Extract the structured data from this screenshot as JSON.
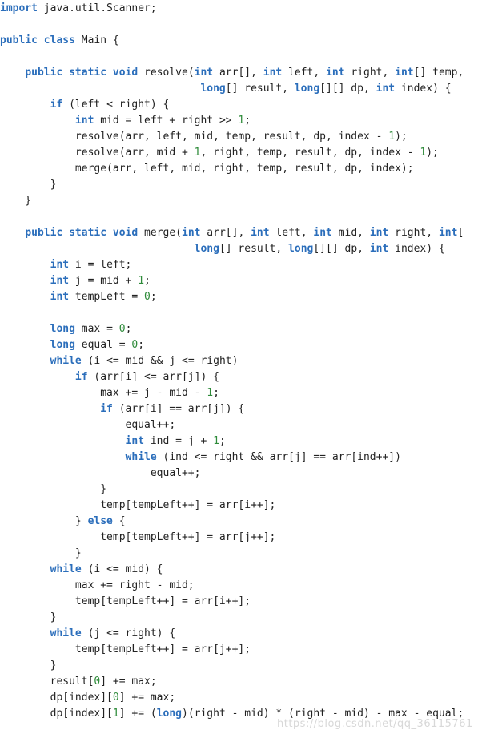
{
  "editor": {
    "language": "java",
    "background_color": "#ffffff",
    "default_text_color": "#222222",
    "keyword_color": "#2B6EBB",
    "number_color": "#2E8B3A",
    "font_size_px": 13,
    "line_height_px": 20
  },
  "watermark": {
    "text": "https://blog.csdn.net/qq_36115761"
  },
  "code": {
    "lines": [
      [
        [
          "kw",
          "import"
        ],
        [
          "plain",
          " java.util.Scanner;"
        ]
      ],
      [],
      [
        [
          "kw",
          "public class"
        ],
        [
          "plain",
          " Main {"
        ]
      ],
      [],
      [
        [
          "plain",
          "    "
        ],
        [
          "kw",
          "public static void"
        ],
        [
          "plain",
          " resolve("
        ],
        [
          "kw",
          "int"
        ],
        [
          "plain",
          " arr[], "
        ],
        [
          "kw",
          "int"
        ],
        [
          "plain",
          " left, "
        ],
        [
          "kw",
          "int"
        ],
        [
          "plain",
          " right, "
        ],
        [
          "kw",
          "int"
        ],
        [
          "plain",
          "[] temp,"
        ]
      ],
      [
        [
          "plain",
          "                                "
        ],
        [
          "kw",
          "long"
        ],
        [
          "plain",
          "[] result, "
        ],
        [
          "kw",
          "long"
        ],
        [
          "plain",
          "[][] dp, "
        ],
        [
          "kw",
          "int"
        ],
        [
          "plain",
          " index) {"
        ]
      ],
      [
        [
          "plain",
          "        "
        ],
        [
          "kw",
          "if"
        ],
        [
          "plain",
          " (left < right) {"
        ]
      ],
      [
        [
          "plain",
          "            "
        ],
        [
          "kw",
          "int"
        ],
        [
          "plain",
          " mid = left + right >> "
        ],
        [
          "num",
          "1"
        ],
        [
          "plain",
          ";"
        ]
      ],
      [
        [
          "plain",
          "            resolve(arr, left, mid, temp, result, dp, index - "
        ],
        [
          "num",
          "1"
        ],
        [
          "plain",
          ");"
        ]
      ],
      [
        [
          "plain",
          "            resolve(arr, mid + "
        ],
        [
          "num",
          "1"
        ],
        [
          "plain",
          ", right, temp, result, dp, index - "
        ],
        [
          "num",
          "1"
        ],
        [
          "plain",
          ");"
        ]
      ],
      [
        [
          "plain",
          "            merge(arr, left, mid, right, temp, result, dp, index);"
        ]
      ],
      [
        [
          "plain",
          "        }"
        ]
      ],
      [
        [
          "plain",
          "    }"
        ]
      ],
      [],
      [
        [
          "plain",
          "    "
        ],
        [
          "kw",
          "public static void"
        ],
        [
          "plain",
          " merge("
        ],
        [
          "kw",
          "int"
        ],
        [
          "plain",
          " arr[], "
        ],
        [
          "kw",
          "int"
        ],
        [
          "plain",
          " left, "
        ],
        [
          "kw",
          "int"
        ],
        [
          "plain",
          " mid, "
        ],
        [
          "kw",
          "int"
        ],
        [
          "plain",
          " right, "
        ],
        [
          "kw",
          "int"
        ],
        [
          "plain",
          "["
        ]
      ],
      [
        [
          "plain",
          "                               "
        ],
        [
          "kw",
          "long"
        ],
        [
          "plain",
          "[] result, "
        ],
        [
          "kw",
          "long"
        ],
        [
          "plain",
          "[][] dp, "
        ],
        [
          "kw",
          "int"
        ],
        [
          "plain",
          " index) {"
        ]
      ],
      [
        [
          "plain",
          "        "
        ],
        [
          "kw",
          "int"
        ],
        [
          "plain",
          " i = left;"
        ]
      ],
      [
        [
          "plain",
          "        "
        ],
        [
          "kw",
          "int"
        ],
        [
          "plain",
          " j = mid + "
        ],
        [
          "num",
          "1"
        ],
        [
          "plain",
          ";"
        ]
      ],
      [
        [
          "plain",
          "        "
        ],
        [
          "kw",
          "int"
        ],
        [
          "plain",
          " tempLeft = "
        ],
        [
          "num",
          "0"
        ],
        [
          "plain",
          ";"
        ]
      ],
      [],
      [
        [
          "plain",
          "        "
        ],
        [
          "kw",
          "long"
        ],
        [
          "plain",
          " max = "
        ],
        [
          "num",
          "0"
        ],
        [
          "plain",
          ";"
        ]
      ],
      [
        [
          "plain",
          "        "
        ],
        [
          "kw",
          "long"
        ],
        [
          "plain",
          " equal = "
        ],
        [
          "num",
          "0"
        ],
        [
          "plain",
          ";"
        ]
      ],
      [
        [
          "plain",
          "        "
        ],
        [
          "kw",
          "while"
        ],
        [
          "plain",
          " (i <= mid && j <= right)"
        ]
      ],
      [
        [
          "plain",
          "            "
        ],
        [
          "kw",
          "if"
        ],
        [
          "plain",
          " (arr[i] <= arr[j]) {"
        ]
      ],
      [
        [
          "plain",
          "                max += j - mid - "
        ],
        [
          "num",
          "1"
        ],
        [
          "plain",
          ";"
        ]
      ],
      [
        [
          "plain",
          "                "
        ],
        [
          "kw",
          "if"
        ],
        [
          "plain",
          " (arr[i] == arr[j]) {"
        ]
      ],
      [
        [
          "plain",
          "                    equal++;"
        ]
      ],
      [
        [
          "plain",
          "                    "
        ],
        [
          "kw",
          "int"
        ],
        [
          "plain",
          " ind = j + "
        ],
        [
          "num",
          "1"
        ],
        [
          "plain",
          ";"
        ]
      ],
      [
        [
          "plain",
          "                    "
        ],
        [
          "kw",
          "while"
        ],
        [
          "plain",
          " (ind <= right && arr[j] == arr[ind++])"
        ]
      ],
      [
        [
          "plain",
          "                        equal++;"
        ]
      ],
      [
        [
          "plain",
          "                }"
        ]
      ],
      [
        [
          "plain",
          "                temp[tempLeft++] = arr[i++];"
        ]
      ],
      [
        [
          "plain",
          "            } "
        ],
        [
          "kw",
          "else"
        ],
        [
          "plain",
          " {"
        ]
      ],
      [
        [
          "plain",
          "                temp[tempLeft++] = arr[j++];"
        ]
      ],
      [
        [
          "plain",
          "            }"
        ]
      ],
      [
        [
          "plain",
          "        "
        ],
        [
          "kw",
          "while"
        ],
        [
          "plain",
          " (i <= mid) {"
        ]
      ],
      [
        [
          "plain",
          "            max += right - mid;"
        ]
      ],
      [
        [
          "plain",
          "            temp[tempLeft++] = arr[i++];"
        ]
      ],
      [
        [
          "plain",
          "        }"
        ]
      ],
      [
        [
          "plain",
          "        "
        ],
        [
          "kw",
          "while"
        ],
        [
          "plain",
          " (j <= right) {"
        ]
      ],
      [
        [
          "plain",
          "            temp[tempLeft++] = arr[j++];"
        ]
      ],
      [
        [
          "plain",
          "        }"
        ]
      ],
      [
        [
          "plain",
          "        result["
        ],
        [
          "num",
          "0"
        ],
        [
          "plain",
          "] += max;"
        ]
      ],
      [
        [
          "plain",
          "        dp[index]["
        ],
        [
          "num",
          "0"
        ],
        [
          "plain",
          "] += max;"
        ]
      ],
      [
        [
          "plain",
          "        dp[index]["
        ],
        [
          "num",
          "1"
        ],
        [
          "plain",
          "] += ("
        ],
        [
          "kw",
          "long"
        ],
        [
          "plain",
          ")(right - mid) * (right - mid) - max - equal;"
        ]
      ]
    ]
  }
}
